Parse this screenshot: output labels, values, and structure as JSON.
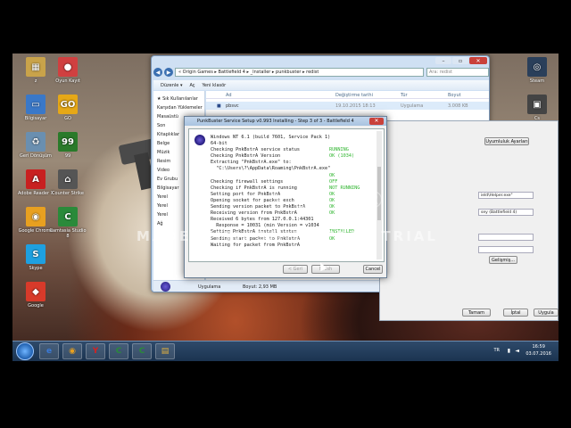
{
  "desktop_icons": [
    {
      "label": "z",
      "color": "#c9a34a",
      "glyph": "▦"
    },
    {
      "label": "Oyun Kayıt",
      "color": "#d04040",
      "glyph": "●"
    },
    {
      "label": "Bilgisayar",
      "color": "#3a78c8",
      "glyph": "▭"
    },
    {
      "label": "GO",
      "color": "#e6a817",
      "glyph": "GO"
    },
    {
      "label": "Geri Dönüşüm",
      "color": "#6a8fb0",
      "glyph": "♻"
    },
    {
      "label": "99",
      "color": "#2a7a2a",
      "glyph": "99"
    },
    {
      "label": "Adobe Reader X",
      "color": "#c82020",
      "glyph": "A"
    },
    {
      "label": "Counter Strike",
      "color": "#555",
      "glyph": "⌂"
    },
    {
      "label": "Google Chrome",
      "color": "#e8a020",
      "glyph": "◉"
    },
    {
      "label": "Camtasia Studio 8",
      "color": "#2a8a3a",
      "glyph": "C"
    },
    {
      "label": "Skype",
      "color": "#1ea0e0",
      "glyph": "S"
    },
    {
      "label": "Google",
      "color": "#d83a2a",
      "glyph": "◆"
    },
    {
      "label": "Steam",
      "color": "#2a3f5a",
      "glyph": "◎"
    },
    {
      "label": "Cs",
      "color": "#444",
      "glyph": "▣"
    }
  ],
  "explorer": {
    "address": "« Origin Games ▸ Battlefield 4 ▸ _Installer ▸ punkbuster ▸ redist",
    "search_placeholder": "Ara: redist",
    "toolbar": {
      "organize": "Düzenle ▾",
      "open": "Aç",
      "new_folder": "Yeni klasör"
    },
    "sidebar": [
      "★ Sık Kullanılanlar",
      "Karşıdan Yüklemeler",
      "Masaüstü",
      "Son",
      "Kitaplıklar",
      "Belge",
      "Müzik",
      "Resim",
      "Video",
      "Ev Grubu",
      "Bilgisayar",
      "Yerel",
      "Yerel",
      "Yerel",
      "Ağ"
    ],
    "columns": {
      "name": "Ad",
      "date": "Değiştirme tarihi",
      "type": "Tür",
      "size": "Boyut"
    },
    "files": [
      {
        "name": "pbsvc",
        "date": "19.10.2015 18:13",
        "type": "Uygulama",
        "size": "3.008 KB"
      }
    ],
    "status": {
      "type": "Uygulama",
      "size": "Boyut: 2,93 MB"
    }
  },
  "properties": {
    "tab": "Uyumluluk Ayarları",
    "field1": "ield\\Helper.exe\"",
    "field2": "sey (Battlefield 4)",
    "change_btn": "Gelişmiş...",
    "ok": "Tamam",
    "cancel": "İptal",
    "apply": "Uygula"
  },
  "setup": {
    "title": "PunkBuster Service Setup v0.993 Installing - Step 3 of 3 - Battlefield 4",
    "log": [
      {
        "text": "Windows NT 6.1 (build 7601, Service Pack 1)",
        "status": ""
      },
      {
        "text": "64-bit",
        "status": ""
      },
      {
        "text": "Checking PnkBstrA service status",
        "status": "RUNNING"
      },
      {
        "text": "Checking PnkBstrA Version",
        "status": "OK (1034)"
      },
      {
        "text": "Extracting \"PnkBstrA.exe\" to:",
        "status": ""
      },
      {
        "text": "  \"C:\\Users\\?\\AppData\\Roaming\\PnkBstrA.exe\"",
        "status": ""
      },
      {
        "text": "",
        "status": "OK"
      },
      {
        "text": "Checking firewall settings",
        "status": "OFF"
      },
      {
        "text": "Checking if PnkBstrA is running",
        "status": "NOT RUNNING"
      },
      {
        "text": "Setting port for PnkBstrA",
        "status": "OK"
      },
      {
        "text": "Opening socket for packet exch",
        "status": "OK"
      },
      {
        "text": "Sending version packet to PnkBstrA",
        "status": "OK"
      },
      {
        "text": "Receiving version from PnkBstrA",
        "status": "OK"
      },
      {
        "text": "Received 6 bytes from 127.0.0.1:44301",
        "status": ""
      },
      {
        "text": "  Response = 10031 (min Version = v1034",
        "status": ""
      },
      {
        "text": "Setting PnkBstrA install status",
        "status": "INSTALLED"
      },
      {
        "text": "Sending start packet to PnkBstrA",
        "status": "OK"
      },
      {
        "text": "Waiting for packet from PnkBstrA",
        "status": ""
      }
    ],
    "back": "< Geri",
    "finish": "Finish",
    "cancel": "Cancel"
  },
  "watermark": {
    "text": "MADE WITH SMITH FREE TRIAL",
    "logo": "✕ Smith®"
  },
  "taskbar": {
    "buttons": [
      {
        "glyph": "e",
        "color": "#3a7ad8"
      },
      {
        "glyph": "◉",
        "color": "#e8a020"
      },
      {
        "glyph": "Y",
        "color": "#d82020"
      },
      {
        "glyph": "C",
        "color": "#2a8a3a"
      },
      {
        "glyph": "C",
        "color": "#2a8a3a"
      },
      {
        "glyph": "▤",
        "color": "#e0b040"
      }
    ],
    "lang": "TR",
    "time": "16:59",
    "date": "03.07.2016"
  }
}
